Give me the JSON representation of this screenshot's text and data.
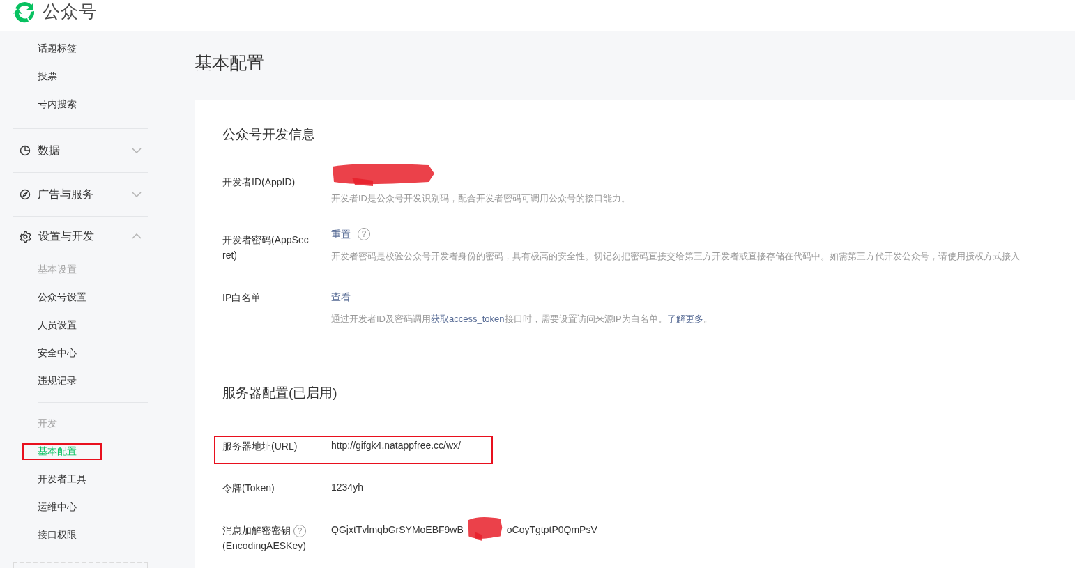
{
  "header": {
    "title": "公众号"
  },
  "sidebar": {
    "items": [
      {
        "kind": "item",
        "label": "话题标签",
        "selected": false,
        "annotated": false
      },
      {
        "kind": "item",
        "label": "投票",
        "selected": false,
        "annotated": false
      },
      {
        "kind": "item",
        "label": "号内搜索",
        "selected": false,
        "annotated": false
      },
      {
        "kind": "group",
        "label": "数据",
        "expanded": false
      },
      {
        "kind": "group",
        "label": "广告与服务",
        "expanded": false
      },
      {
        "kind": "group",
        "label": "设置与开发",
        "expanded": true
      },
      {
        "kind": "heading",
        "label": "基本设置"
      },
      {
        "kind": "item",
        "label": "公众号设置",
        "selected": false,
        "annotated": false
      },
      {
        "kind": "item",
        "label": "人员设置",
        "selected": false,
        "annotated": false
      },
      {
        "kind": "item",
        "label": "安全中心",
        "selected": false,
        "annotated": false
      },
      {
        "kind": "item",
        "label": "违规记录",
        "selected": false,
        "annotated": false
      },
      {
        "kind": "divider"
      },
      {
        "kind": "heading",
        "label": "开发"
      },
      {
        "kind": "item",
        "label": "基本配置",
        "selected": true,
        "annotated": true
      },
      {
        "kind": "item",
        "label": "开发者工具",
        "selected": false,
        "annotated": false
      },
      {
        "kind": "item",
        "label": "运维中心",
        "selected": false,
        "annotated": false
      },
      {
        "kind": "item",
        "label": "接口权限",
        "selected": false,
        "annotated": false
      }
    ]
  },
  "page_title": "基本配置",
  "sections": [
    {
      "title": "公众号开发信息",
      "rows": [
        {
          "label": "开发者ID(AppID)",
          "redacted": true,
          "description": [
            {
              "text": "开发者ID是公众号开发识别码，配合开发者密码可调用公众号的接口能力。",
              "link": false
            }
          ]
        },
        {
          "label": "开发者密码(AppSecret)",
          "action": "重置",
          "help": "?",
          "description": [
            {
              "text": "开发者密码是校验公众号开发者身份的密码，具有极高的安全性。切记勿把密码直接交给第三方开发者或直接存储在代码中。如需第三方代开发公众号，请使用授权方式接入",
              "link": false
            }
          ]
        },
        {
          "label": "IP白名单",
          "action": "查看",
          "description": [
            {
              "text": "通过开发者ID及密码调用",
              "link": false
            },
            {
              "text": "获取access_token",
              "link": true
            },
            {
              "text": "接口时，需要设置访问来源IP为白名单。",
              "link": false
            },
            {
              "text": "了解更多",
              "link": true
            },
            {
              "text": "。",
              "link": false
            }
          ]
        }
      ]
    },
    {
      "title": "服务器配置(已启用)",
      "rows": [
        {
          "label": "服务器地址(URL)",
          "value": "http://gifgk4.natappfree.cc/wx/",
          "annotated": true
        },
        {
          "label": "令牌(Token)",
          "value": "1234yh"
        },
        {
          "label": "消息加解密密钥",
          "label_help": "?",
          "label_line2": "(EncodingAESKey)",
          "value": "QGjxtTvlmqbGrSYMoEBF9wB",
          "value_end": "oCoyTgtptP0QmPsV",
          "redacted": true
        }
      ]
    }
  ]
}
